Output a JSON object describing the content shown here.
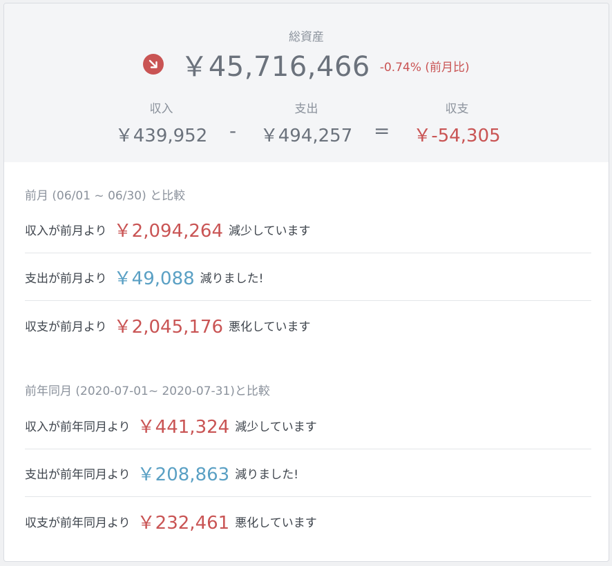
{
  "summary": {
    "title": "総資産",
    "total": "￥45,716,466",
    "change": "-0.74% (前月比)",
    "income_label": "収入",
    "income": "￥439,952",
    "minus": "-",
    "expense_label": "支出",
    "expense": "￥494,257",
    "equals": "=",
    "balance_label": "収支",
    "balance": "￥-54,305"
  },
  "prev_month": {
    "title": "前月 (06/01 ~ 06/30) と比較",
    "rows": [
      {
        "prefix": "収入が前月より",
        "amount": "￥2,094,264",
        "suffix": "減少しています"
      },
      {
        "prefix": "支出が前月より",
        "amount": "￥49,088",
        "suffix": "減りました!"
      },
      {
        "prefix": "収支が前月より",
        "amount": "￥2,045,176",
        "suffix": "悪化しています"
      }
    ]
  },
  "prev_year": {
    "title": "前年同月 (2020-07-01~ 2020-07-31)と比較",
    "rows": [
      {
        "prefix": "収入が前年同月より",
        "amount": "￥441,324",
        "suffix": "減少しています"
      },
      {
        "prefix": "支出が前年同月より",
        "amount": "￥208,863",
        "suffix": "減りました!"
      },
      {
        "prefix": "収支が前年同月より",
        "amount": "￥232,461",
        "suffix": "悪化しています"
      }
    ]
  },
  "colors": {
    "negative": "#c95454",
    "positive": "#5aa0c4"
  },
  "icons": {
    "trend": "arrow-down-right-icon"
  }
}
